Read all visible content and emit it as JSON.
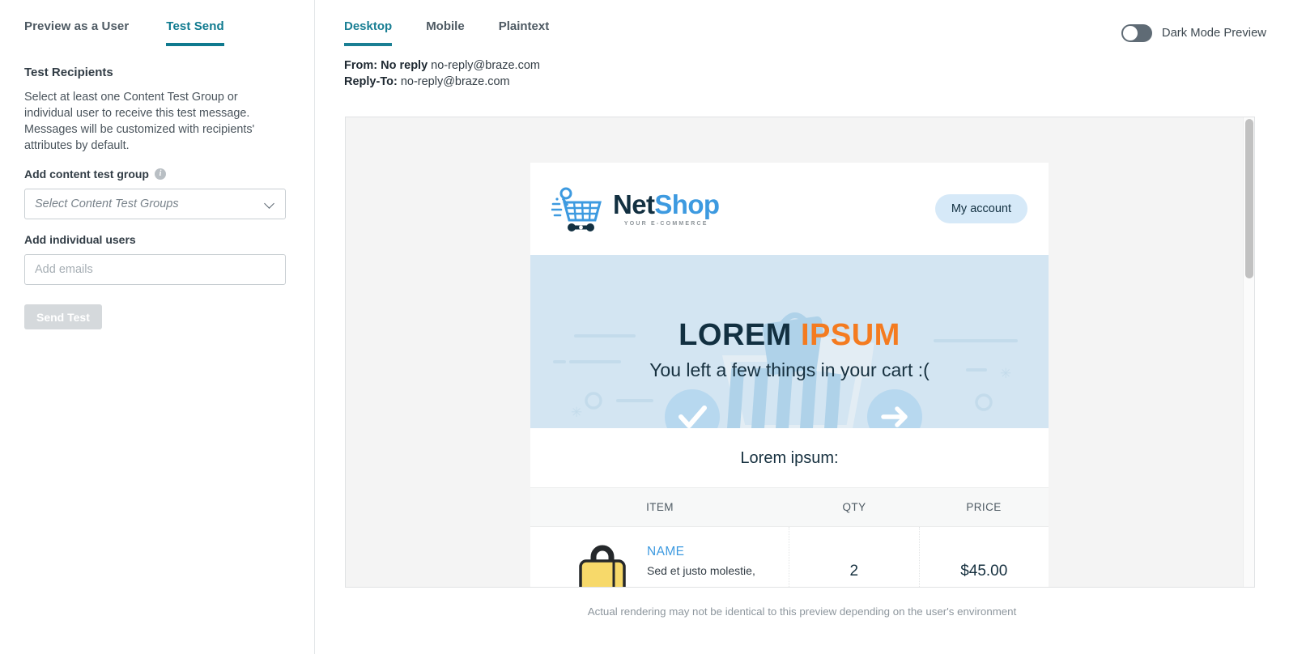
{
  "left_panel": {
    "tabs": [
      {
        "label": "Preview as a User",
        "active": false
      },
      {
        "label": "Test Send",
        "active": true
      }
    ],
    "section_title": "Test Recipients",
    "description": "Select at least one Content Test Group or individual user to receive this test message. Messages will be customized with recipients' attributes by default.",
    "content_group_label": "Add content test group",
    "info_icon": "info-icon",
    "content_group_placeholder": "Select Content Test Groups",
    "content_group_value": "",
    "individual_users_label": "Add individual users",
    "individual_users_placeholder": "Add emails",
    "individual_users_value": "",
    "send_button_label": "Send Test"
  },
  "right_panel": {
    "tabs": [
      {
        "label": "Desktop",
        "active": true
      },
      {
        "label": "Mobile",
        "active": false
      },
      {
        "label": "Plaintext",
        "active": false
      }
    ],
    "dark_mode_label": "Dark Mode Preview",
    "dark_mode_enabled": false,
    "from_label": "From:",
    "from_name": "No reply",
    "from_email": "no-reply@braze.com",
    "reply_to_label": "Reply-To:",
    "reply_to_email": "no-reply@braze.com",
    "footnote": "Actual rendering may not be identical to this preview depending on the user's environment"
  },
  "email_preview": {
    "logo": {
      "word_part_1": "Net",
      "word_part_2": "Shop",
      "tagline": "YOUR E-COMMERCE",
      "icon": "shopping-cart-icon"
    },
    "account_button_label": "My account",
    "hero": {
      "title_part_1": "LOREM",
      "title_part_2": "IPSUM",
      "subtitle": "You left a few things in your cart :(",
      "check_icon": "check-circle-icon",
      "arrow_icon": "arrow-right-circle-icon"
    },
    "section_title": "Lorem ipsum:",
    "table": {
      "headers": [
        "ITEM",
        "QTY",
        "PRICE"
      ],
      "rows": [
        {
          "thumb": "yellow-bag-icon",
          "name": "NAME",
          "desc": "Sed et justo molestie,",
          "qty": "2",
          "price": "$45.00"
        }
      ]
    }
  },
  "colors": {
    "accent_teal": "#1a7f94",
    "brand_blue": "#3d9ae0",
    "brand_navy": "#123041",
    "hero_bg": "#d3e5f2",
    "orange": "#f47b20",
    "account_btn_bg": "#d6e9f8"
  }
}
